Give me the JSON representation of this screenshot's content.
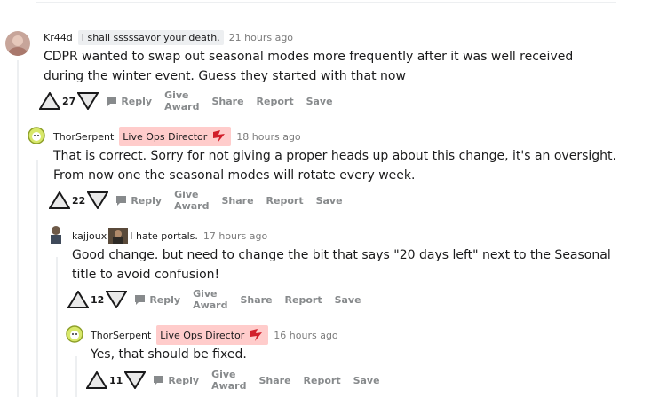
{
  "comments": [
    {
      "author": "Kr44d",
      "flair": "I shall sssssavor your death.",
      "time": "21 hours ago",
      "body": "CDPR wanted to swap out seasonal modes more frequently after it was well received during the winter event. Guess they started with that now",
      "votes": "27"
    },
    {
      "author": "ThorSerpent",
      "flair": "Live Ops Director",
      "time": "18 hours ago",
      "body": "That is correct. Sorry for not giving a proper heads up about this change, it's an oversight. From now one the seasonal modes will rotate every week.",
      "votes": "22"
    },
    {
      "author": "kajjoux",
      "flair": "I hate portals.",
      "time": "17 hours ago",
      "body": "Good change. but need to change the bit that says \"20 days left\" next to the Seasonal title to avoid confusion!",
      "votes": "12"
    },
    {
      "author": "ThorSerpent",
      "flair": "Live Ops Director",
      "time": "16 hours ago",
      "body": "Yes, that should be fixed.",
      "votes": "11"
    }
  ],
  "actions": {
    "reply": "Reply",
    "give_award": "Give Award",
    "share": "Share",
    "report": "Report",
    "save": "Save"
  },
  "colors": {
    "staff_flair_bg": "#ffcccb",
    "flair_bg": "#edeff1",
    "meta_text": "#7c7c7c",
    "action_text": "#878a8c"
  }
}
